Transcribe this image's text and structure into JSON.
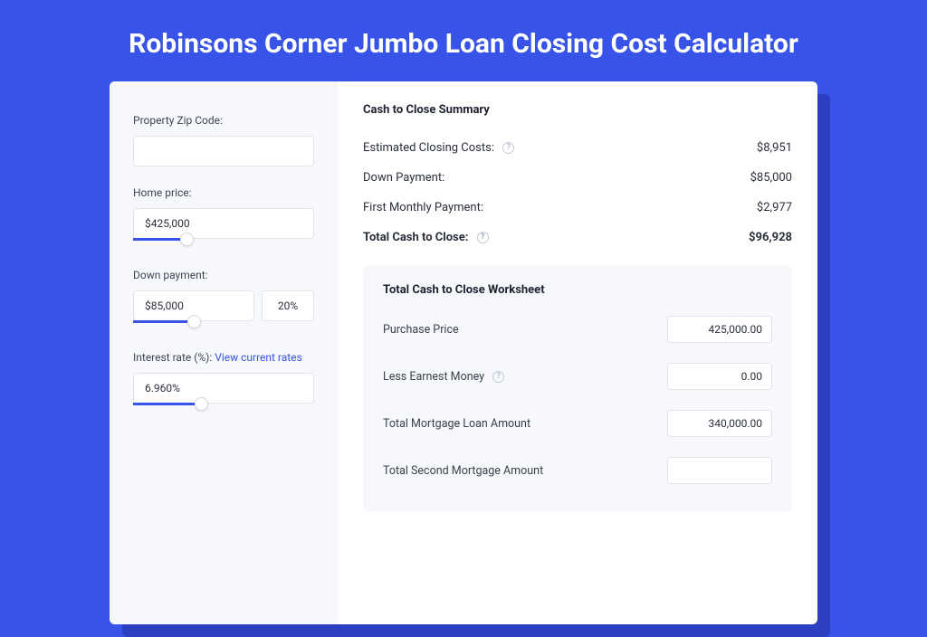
{
  "title": "Robinsons Corner Jumbo Loan Closing Cost Calculator",
  "left": {
    "zip": {
      "label": "Property Zip Code:",
      "value": ""
    },
    "price": {
      "label": "Home price:",
      "value": "$425,000",
      "slider_fill_pct": 26,
      "thumb_pct": 26
    },
    "down": {
      "label": "Down payment:",
      "value": "$85,000",
      "pct": "20%",
      "slider_fill_pct": 30,
      "thumb_pct": 30
    },
    "rate": {
      "label": "Interest rate (%):",
      "link": "View current rates",
      "value": "6.960%",
      "slider_fill_pct": 34,
      "thumb_pct": 34
    }
  },
  "summary": {
    "title": "Cash to Close Summary",
    "rows": [
      {
        "label": "Estimated Closing Costs:",
        "help": true,
        "value": "$8,951"
      },
      {
        "label": "Down Payment:",
        "help": false,
        "value": "$85,000"
      },
      {
        "label": "First Monthly Payment:",
        "help": false,
        "value": "$2,977"
      }
    ],
    "total": {
      "label": "Total Cash to Close:",
      "help": true,
      "value": "$96,928"
    }
  },
  "worksheet": {
    "title": "Total Cash to Close Worksheet",
    "rows": [
      {
        "label": "Purchase Price",
        "help": false,
        "value": "425,000.00"
      },
      {
        "label": "Less Earnest Money",
        "help": true,
        "value": "0.00"
      },
      {
        "label": "Total Mortgage Loan Amount",
        "help": false,
        "value": "340,000.00"
      },
      {
        "label": "Total Second Mortgage Amount",
        "help": false,
        "value": ""
      }
    ]
  }
}
